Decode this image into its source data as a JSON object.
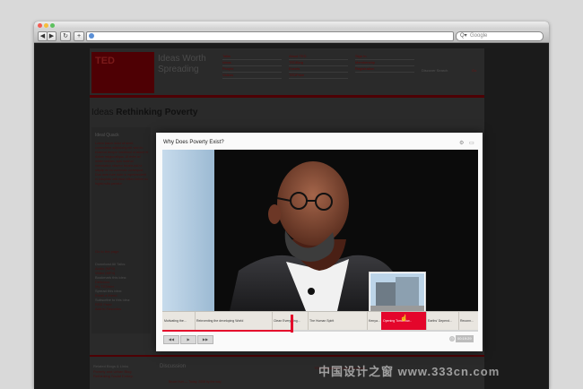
{
  "browser": {
    "back": "◀",
    "forward": "▶",
    "reload": "↻",
    "add": "+",
    "search_placeholder": "Google",
    "search_glyph": "Q▾"
  },
  "site": {
    "logo": "TED",
    "tagline": "Ideas Worth Spreading",
    "nav_col1": [
      "Talks",
      "Ideas",
      "People",
      "Videos"
    ],
    "nav_col2": [
      "About TED",
      "TEDBlog",
      "Events",
      "TEDPrize"
    ],
    "nav_col3": [
      "Sign In",
      "Membership",
      "Registration"
    ],
    "search_label": "Discover Search",
    "search_go": "Go",
    "heading_prefix": "Ideas",
    "heading_main": "Rethinking Poverty"
  },
  "sidebar": {
    "title": "Ideal Quack",
    "body": "Lorem ipsum dolor sit amet, consectetur adipisicing elit, sed do eiusmod tempor incididunt ut labore et dolore magna aliqua. Ut enim ad minim veniam, quis nostrud exercitation ullamco laboris nisi ut aliquip ex ea commodo consequat. Duis aute irure dolor in reprehenderit in voluptate velit esse cillum dolore eu fugiat nulla pariatur.",
    "link": "Go to the page",
    "download_title": "Download All Talks:",
    "download_links": [
      "Audio (MP3)",
      "Video (MP4)"
    ],
    "bookmark_title": "Bookmark this idea:",
    "bookmark_links": [
      "Delicious",
      "My TEDster"
    ],
    "spread_title": "Spread this idea:",
    "spread_links": [
      "Email a friend"
    ],
    "subscribe_title": "Subscribe to this idea:",
    "subscribe_links": [
      "RSS Feed",
      "Add to Favorites"
    ]
  },
  "footer": {
    "related_title": "Related Blogs & Links",
    "related_links": [
      "Poverty and Urban Blog",
      "Rethinking Social Entrep."
    ],
    "discussion_label": "Discussion",
    "discussion_options": "TED Discussion  |  Add Comment",
    "bruce": "Bruce Hurt — Today, 2008 by the way"
  },
  "player": {
    "title": "Why Does Poverty Exist?",
    "chapters": [
      {
        "label": "Motivating the...",
        "active": false
      },
      {
        "label": "Reinventing the developing World",
        "active": false
      },
      {
        "label": "Clean Everything...",
        "active": false
      },
      {
        "label": "The Human Spirit",
        "active": false
      },
      {
        "label": "Kenya...",
        "active": false
      },
      {
        "label": "Opening Tomorrow...",
        "active": true
      },
      {
        "label": "Earths' Depend...",
        "active": false
      },
      {
        "label": "Reconn...",
        "active": false
      }
    ],
    "progress": 0.41,
    "controls": [
      "◀◀",
      "▶",
      "▶▶"
    ],
    "time": "00:19:29",
    "colors": {
      "accent": "#e4062b"
    }
  },
  "watermark": "中国设计之窗 www.333cn.com"
}
